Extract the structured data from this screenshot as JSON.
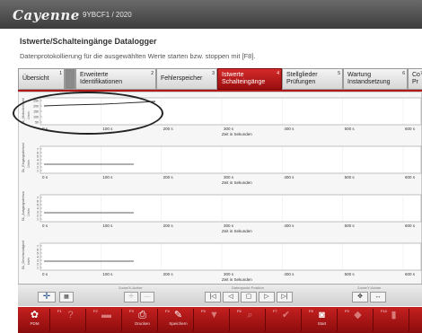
{
  "header": {
    "brand": "Cayenne",
    "vin": "9YBCF1 / 2020"
  },
  "page": {
    "title": "Istwerte/Schalteingänge Datalogger",
    "subtitle": "Datenprotokollierung für die ausgewählten Werte starten bzw. stoppen mit [F8]."
  },
  "tabs": [
    {
      "label": "Übersicht",
      "num": "1"
    },
    {
      "label1": "Erweiterte",
      "label2": "Identifikationen",
      "num": "2"
    },
    {
      "label": "Fehlerspeicher",
      "num": "3"
    },
    {
      "label1": "Istwerte",
      "label2": "Schalteingänge",
      "num": "4",
      "active": true
    },
    {
      "label1": "Stellglieder",
      "label2": "Prüfungen",
      "num": "5"
    },
    {
      "label1": "Wartung",
      "label2": "Instandsetzung",
      "num": "6"
    },
    {
      "label1": "Co",
      "label2": "Pr",
      "num": "7"
    }
  ],
  "charts": [
    {
      "ylabel": "DL_Motordrehzahl",
      "unit": "1/min",
      "yticks": [
        "250",
        "200",
        "150",
        "100",
        "50"
      ],
      "has_line": true
    },
    {
      "ylabel": "DL_Eingangsdrehzahl",
      "unit": "1/min",
      "yticks": [
        "7",
        "6",
        "5",
        "4",
        "3",
        "2",
        "1"
      ],
      "has_line": false
    },
    {
      "ylabel": "DL_Ausgangsdrehzahl",
      "unit": "1/min",
      "yticks": [
        "7",
        "6",
        "5",
        "4",
        "3",
        "2",
        "1"
      ],
      "has_line": false
    },
    {
      "ylabel": "DL_Geschwindigkeit",
      "unit": "km/h",
      "yticks": [
        "7",
        "6",
        "5",
        "4",
        "3",
        "2",
        "1"
      ],
      "has_line": false
    }
  ],
  "xaxis": {
    "ticks": [
      "0 s",
      "100 s",
      "200 s",
      "300 s",
      "400 s",
      "500 s",
      "600 s"
    ],
    "label": "Zeit in Sekunden"
  },
  "controls": {
    "group1_label": "Zoom/X-Achse",
    "group2_label": "Datenpunkt Position",
    "group3_label": "Zoom/Y-Achse",
    "player": [
      "|◁",
      "◁",
      "▢",
      "▷",
      "▷|"
    ],
    "zoom_y": [
      "✥",
      "↔"
    ]
  },
  "bottom_buttons": [
    {
      "icon": "✿",
      "label": "PDM",
      "fn": "",
      "name": "pdm-button"
    },
    {
      "icon": "?",
      "label": "",
      "fn": "F1",
      "name": "help-button"
    },
    {
      "icon": "▬",
      "label": "",
      "fn": "F2",
      "name": "info-button"
    },
    {
      "icon": "⎙",
      "label": "Drucken",
      "fn": "F3",
      "name": "print-button"
    },
    {
      "icon": "✎",
      "label": "Speichern",
      "fn": "F4",
      "name": "save-button"
    },
    {
      "icon": "▼",
      "label": "",
      "fn": "F5",
      "name": "filter-button"
    },
    {
      "icon": "⌕",
      "label": "",
      "fn": "F6",
      "name": "search-button"
    },
    {
      "icon": "✔",
      "label": "",
      "fn": "F7",
      "name": "check-button"
    },
    {
      "icon": "◙",
      "label": "Start",
      "fn": "F8",
      "name": "start-button"
    },
    {
      "icon": "◆",
      "label": "",
      "fn": "F9",
      "name": "flag-button"
    },
    {
      "icon": "▮",
      "label": "",
      "fn": "F10",
      "name": "end-button"
    }
  ],
  "colors": {
    "accent": "#b21a1a",
    "trace": "#2a2a2a"
  }
}
